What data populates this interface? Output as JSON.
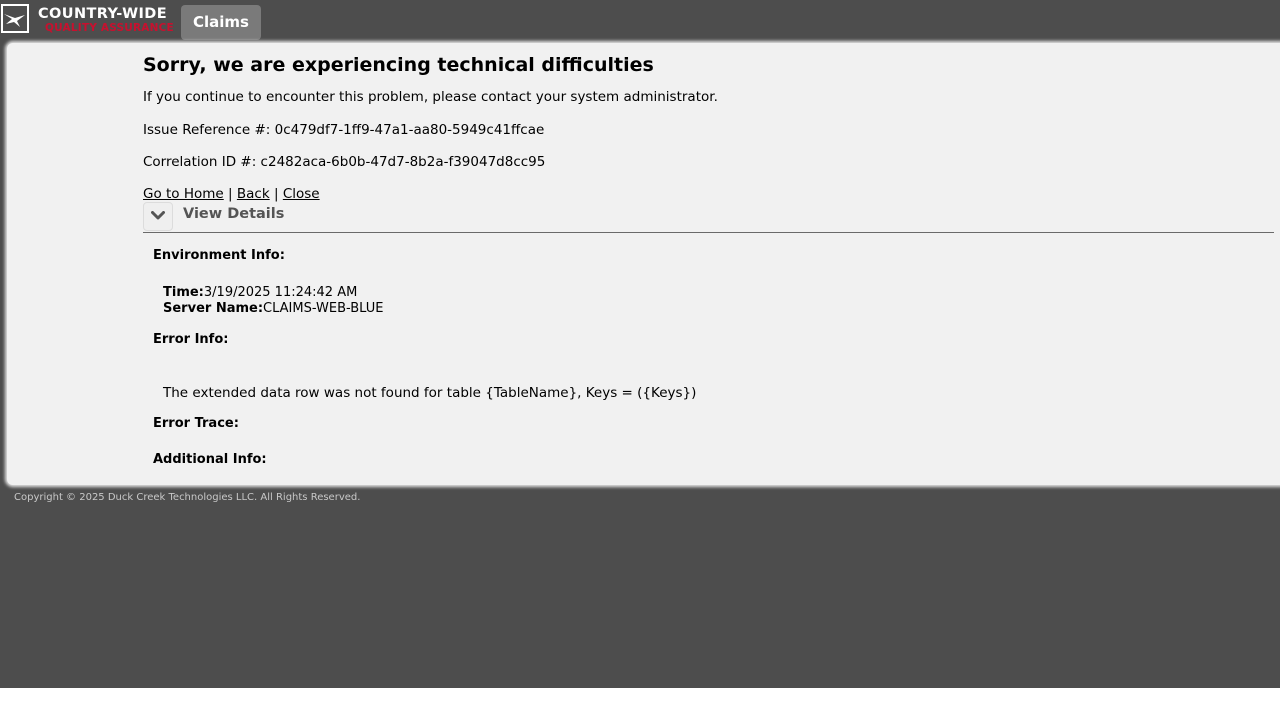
{
  "header": {
    "logo_title": "COUNTRY-WIDE",
    "logo_subtitle": "QUALITY ASSURANCE",
    "tab_label": "Claims"
  },
  "error": {
    "title": "Sorry, we are experiencing technical difficulties",
    "message": "If you continue to encounter this problem, please contact your system administrator.",
    "issue_reference": "Issue Reference #: 0c479df7-1ff9-47a1-aa80-5949c41ffcae",
    "correlation_id": "Correlation ID #: c2482aca-6b0b-47d7-8b2a-f39047d8cc95"
  },
  "links": {
    "home": "Go to Home",
    "back": "Back",
    "close": "Close",
    "separator": "|"
  },
  "details": {
    "toggle_label": "View Details",
    "environment_heading": "Environment Info:",
    "time_label": "Time:",
    "time_value": "3/19/2025 11:24:42 AM",
    "server_label": "Server Name:",
    "server_value": "CLAIMS-WEB-BLUE",
    "error_heading": "Error Info:",
    "error_message": "The extended data row was not found for table {TableName}, Keys = ({Keys})",
    "trace_heading": "Error Trace:",
    "additional_heading": "Additional Info:"
  },
  "footer": {
    "copyright": "Copyright © 2025 Duck Creek Technologies LLC. All Rights Reserved."
  },
  "colors": {
    "background": "#4d4d4d",
    "panel": "#f1f1f1",
    "brand_red": "#c8102e",
    "tab": "#7a7a7a"
  },
  "icons": {
    "logo": "eagle-logo-icon",
    "toggle": "chevron-down-icon"
  }
}
